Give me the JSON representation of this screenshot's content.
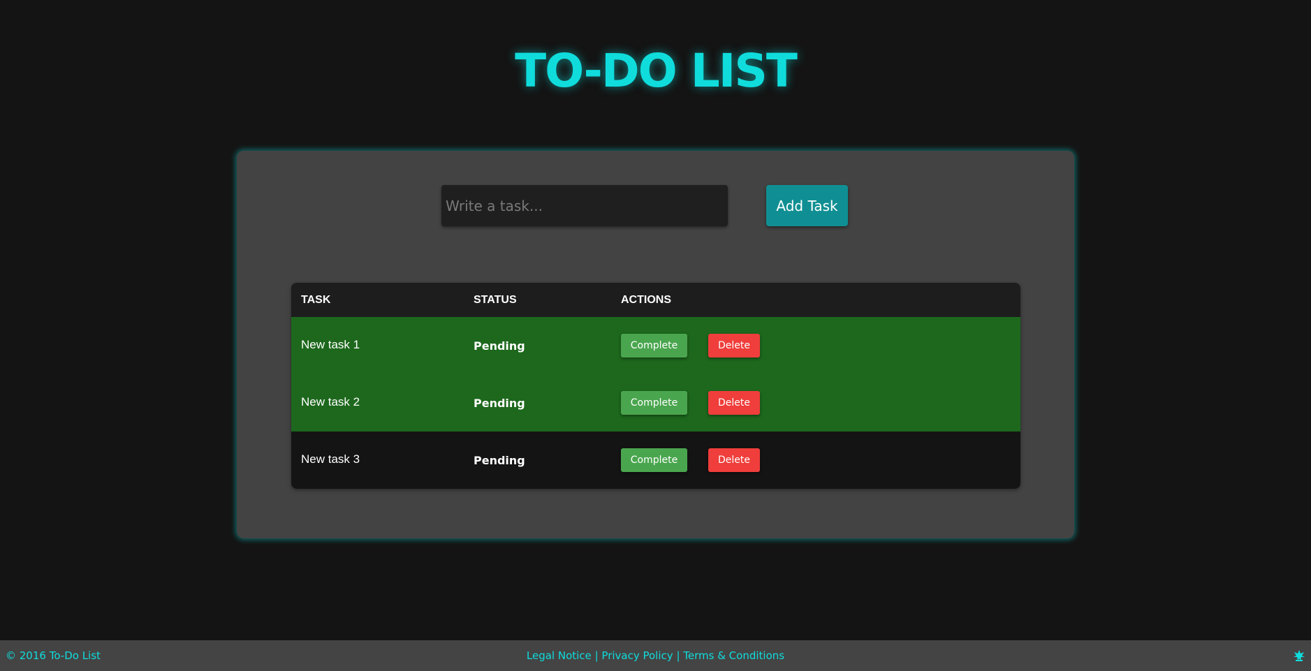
{
  "title": "TO-DO LIST",
  "input": {
    "placeholder": "Write a task..."
  },
  "add_button": "Add Task",
  "table": {
    "headers": [
      "TASK",
      "STATUS",
      "ACTIONS"
    ],
    "rows": [
      {
        "task": "New task 1",
        "status": "Pending",
        "complete": "Complete",
        "delete": "Delete"
      },
      {
        "task": "New task 2",
        "status": "Pending",
        "complete": "Complete",
        "delete": "Delete"
      },
      {
        "task": "New task 3",
        "status": "Pending",
        "complete": "Complete",
        "delete": "Delete"
      }
    ]
  },
  "footer": {
    "copyright": "© 2016 To-Do List",
    "links": [
      "Legal Notice",
      "Privacy Policy",
      "Terms & Conditions"
    ],
    "separator": "|",
    "icon": "cyan-emblem-icon"
  },
  "colors": {
    "background": "#141414",
    "accent": "#10dcdc",
    "panel": "#434343",
    "add_button": "#0f8f93",
    "highlight_row": "#1d681d",
    "complete_button": "#4aa64e",
    "delete_button": "#ef3e3b"
  }
}
